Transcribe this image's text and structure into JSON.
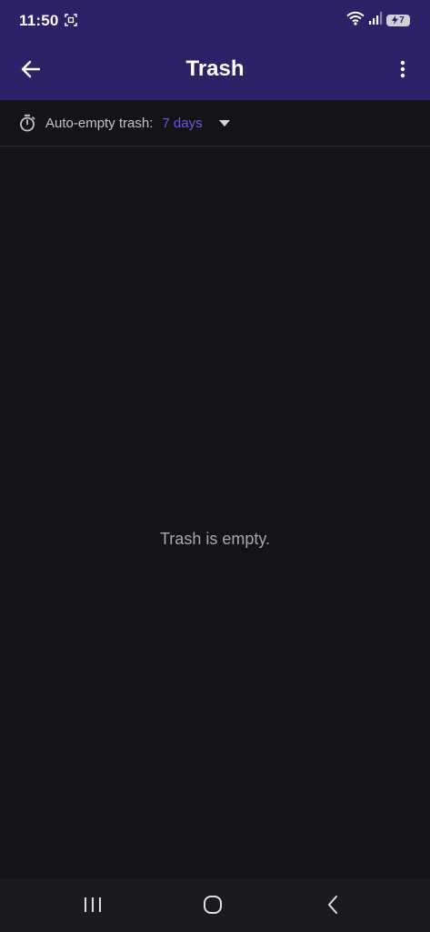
{
  "status_bar": {
    "time": "11:50",
    "battery_level": "7",
    "icons": [
      "screenshot-icon",
      "wifi-icon",
      "signal-icon",
      "battery-icon"
    ]
  },
  "app_bar": {
    "title": "Trash",
    "back_icon": "arrow-back-icon",
    "more_icon": "more-vert-icon"
  },
  "auto_empty": {
    "icon": "timer-icon",
    "label": "Auto-empty trash:",
    "value": "7 days"
  },
  "empty_state": {
    "message": "Trash is empty."
  },
  "nav_bar": {
    "icons": [
      "recent-apps-icon",
      "home-icon",
      "back-icon"
    ]
  },
  "colors": {
    "app_bar": "#2e2167",
    "background": "#141318",
    "accent": "#6f55e0",
    "text_secondary": "#a9a8b1"
  }
}
